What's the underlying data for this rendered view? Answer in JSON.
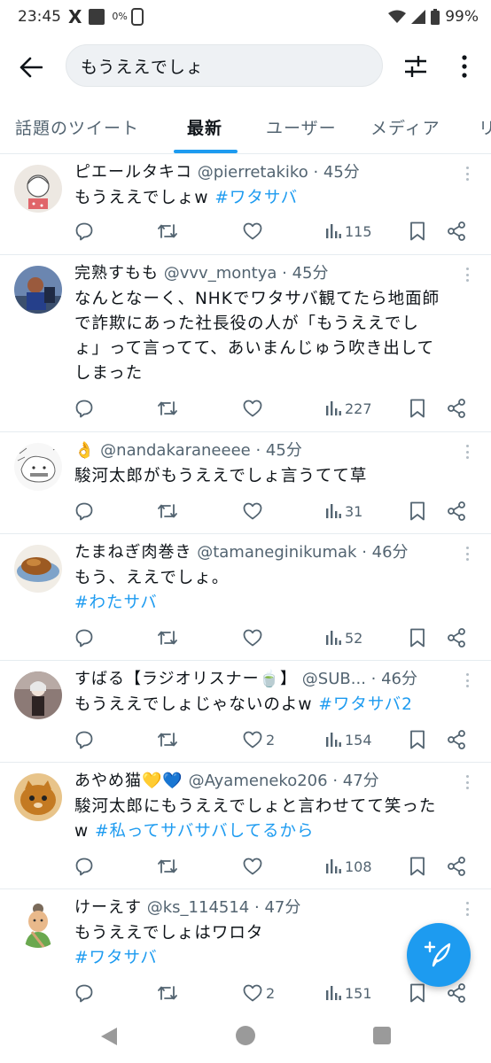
{
  "status_bar": {
    "time": "23:45",
    "x_glyph": "X",
    "small_indicator": "0%",
    "battery": "99%"
  },
  "search": {
    "query": "もうええでしょ"
  },
  "tabs": [
    {
      "label": "話題のツイート",
      "active": false
    },
    {
      "label": "最新",
      "active": true
    },
    {
      "label": "ユーザー",
      "active": false
    },
    {
      "label": "メディア",
      "active": false
    },
    {
      "label": "リ",
      "active": false
    }
  ],
  "tweets": [
    {
      "name": "ピエールタキコ",
      "handle": "@pierretakiko",
      "time": "45分",
      "text_parts": [
        "もうええでしょw ",
        "#ワタサバ"
      ],
      "likes": "",
      "views": "115",
      "avatar_color": "#e9e4df"
    },
    {
      "name": "完熟すもも",
      "handle": "@vvv_montya",
      "time": "45分",
      "text_lines": [
        "なんとなーく、NHKでワタサバ観てたら地面師",
        "で詐欺にあった社長役の人が「もうええでし",
        "ょ」って言ってて、あいまんじゅう吹き出して",
        "しまった"
      ],
      "likes": "",
      "views": "227",
      "avatar_color": "#4a6fa5"
    },
    {
      "name": "👌",
      "handle": "@nandakaraneeee",
      "time": "45分",
      "text_parts": [
        "駿河太郎がもうええでしょ言うてて草"
      ],
      "likes": "",
      "views": "31",
      "avatar_color": "#f4f4f4"
    },
    {
      "name": "たまねぎ肉巻き",
      "handle": "@tamaneginikumak",
      "time": "46分",
      "text_lines": [
        "もう、ええでしょ。"
      ],
      "tag_line": "#わたサバ",
      "likes": "",
      "views": "52",
      "avatar_color": "#c98a3d"
    },
    {
      "name": "すばる【ラジオリスナー🍵】",
      "handle": "@SUB...",
      "time": "46分",
      "text_parts": [
        "もうええでしょじゃないのよw ",
        "#ワタサバ2"
      ],
      "likes": "2",
      "views": "154",
      "avatar_color": "#5b4a46"
    },
    {
      "name": "あやめ猫💛💙",
      "handle": "@Ayameneko206",
      "time": "47分",
      "text_lines": [
        "駿河太郎にもうええでしょと言わせてて笑った"
      ],
      "text_parts2": [
        "w ",
        "#私ってサバサバしてるから"
      ],
      "likes": "",
      "views": "108",
      "avatar_color": "#d08a2c"
    },
    {
      "name": "けーえす",
      "handle": "@ks_114514",
      "time": "47分",
      "text_lines": [
        "もうええでしょはワロタ"
      ],
      "tag_line": "#ワタサバ",
      "likes": "2",
      "views": "151",
      "avatar_color": "#f4e7d2"
    }
  ],
  "colors": {
    "accent": "#1d9bf0",
    "text": "#0f1419",
    "muted": "#536471"
  }
}
